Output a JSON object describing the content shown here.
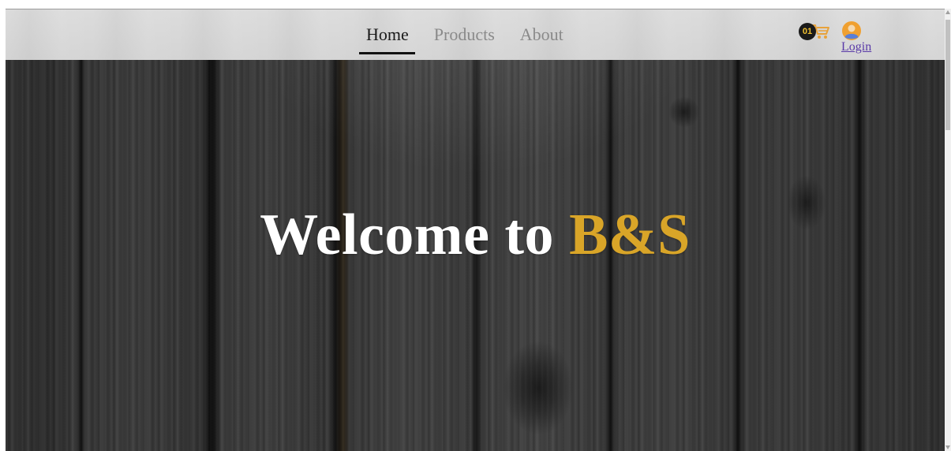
{
  "nav": {
    "items": [
      {
        "label": "Home",
        "active": true
      },
      {
        "label": "Products",
        "active": false
      },
      {
        "label": "About",
        "active": false
      }
    ]
  },
  "cart": {
    "count": "01",
    "icon": "shopping-cart-icon",
    "color": "#e8a23a"
  },
  "user": {
    "icon": "user-avatar-icon",
    "login_label": "Login",
    "avatar_color": "#f0a030",
    "avatar_figure_color": "#5a7fd6"
  },
  "hero": {
    "headline_prefix": "Welcome to ",
    "headline_brand": "B&S",
    "brand_color": "#d9a528"
  },
  "colors": {
    "nav_active": "#1a1a1a",
    "nav_inactive": "#8a8a8a",
    "link": "#5a3aa8"
  }
}
